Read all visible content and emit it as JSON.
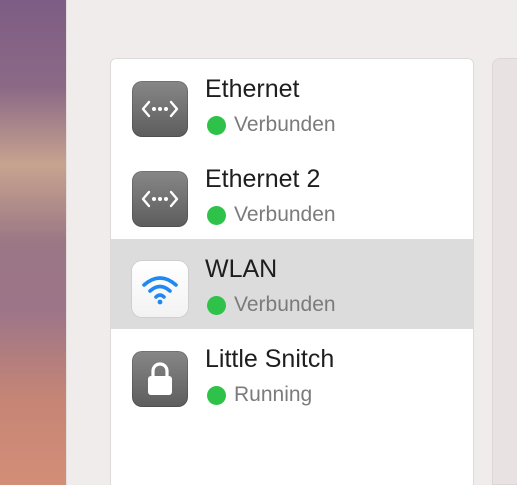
{
  "colors": {
    "status_green": "#2fc24a",
    "icon_dark": "#6e6e6e",
    "wifi_blue": "#1f88f2",
    "selected_row": "#dcdcdc"
  },
  "services": [
    {
      "name": "Ethernet",
      "status": "Verbunden",
      "icon": "ethernet-icon",
      "selected": false
    },
    {
      "name": "Ethernet 2",
      "status": "Verbunden",
      "icon": "ethernet-icon",
      "selected": false
    },
    {
      "name": "WLAN",
      "status": "Verbunden",
      "icon": "wifi-icon",
      "selected": true
    },
    {
      "name": "Little Snitch",
      "status": "Running",
      "icon": "lock-icon",
      "selected": false
    }
  ]
}
